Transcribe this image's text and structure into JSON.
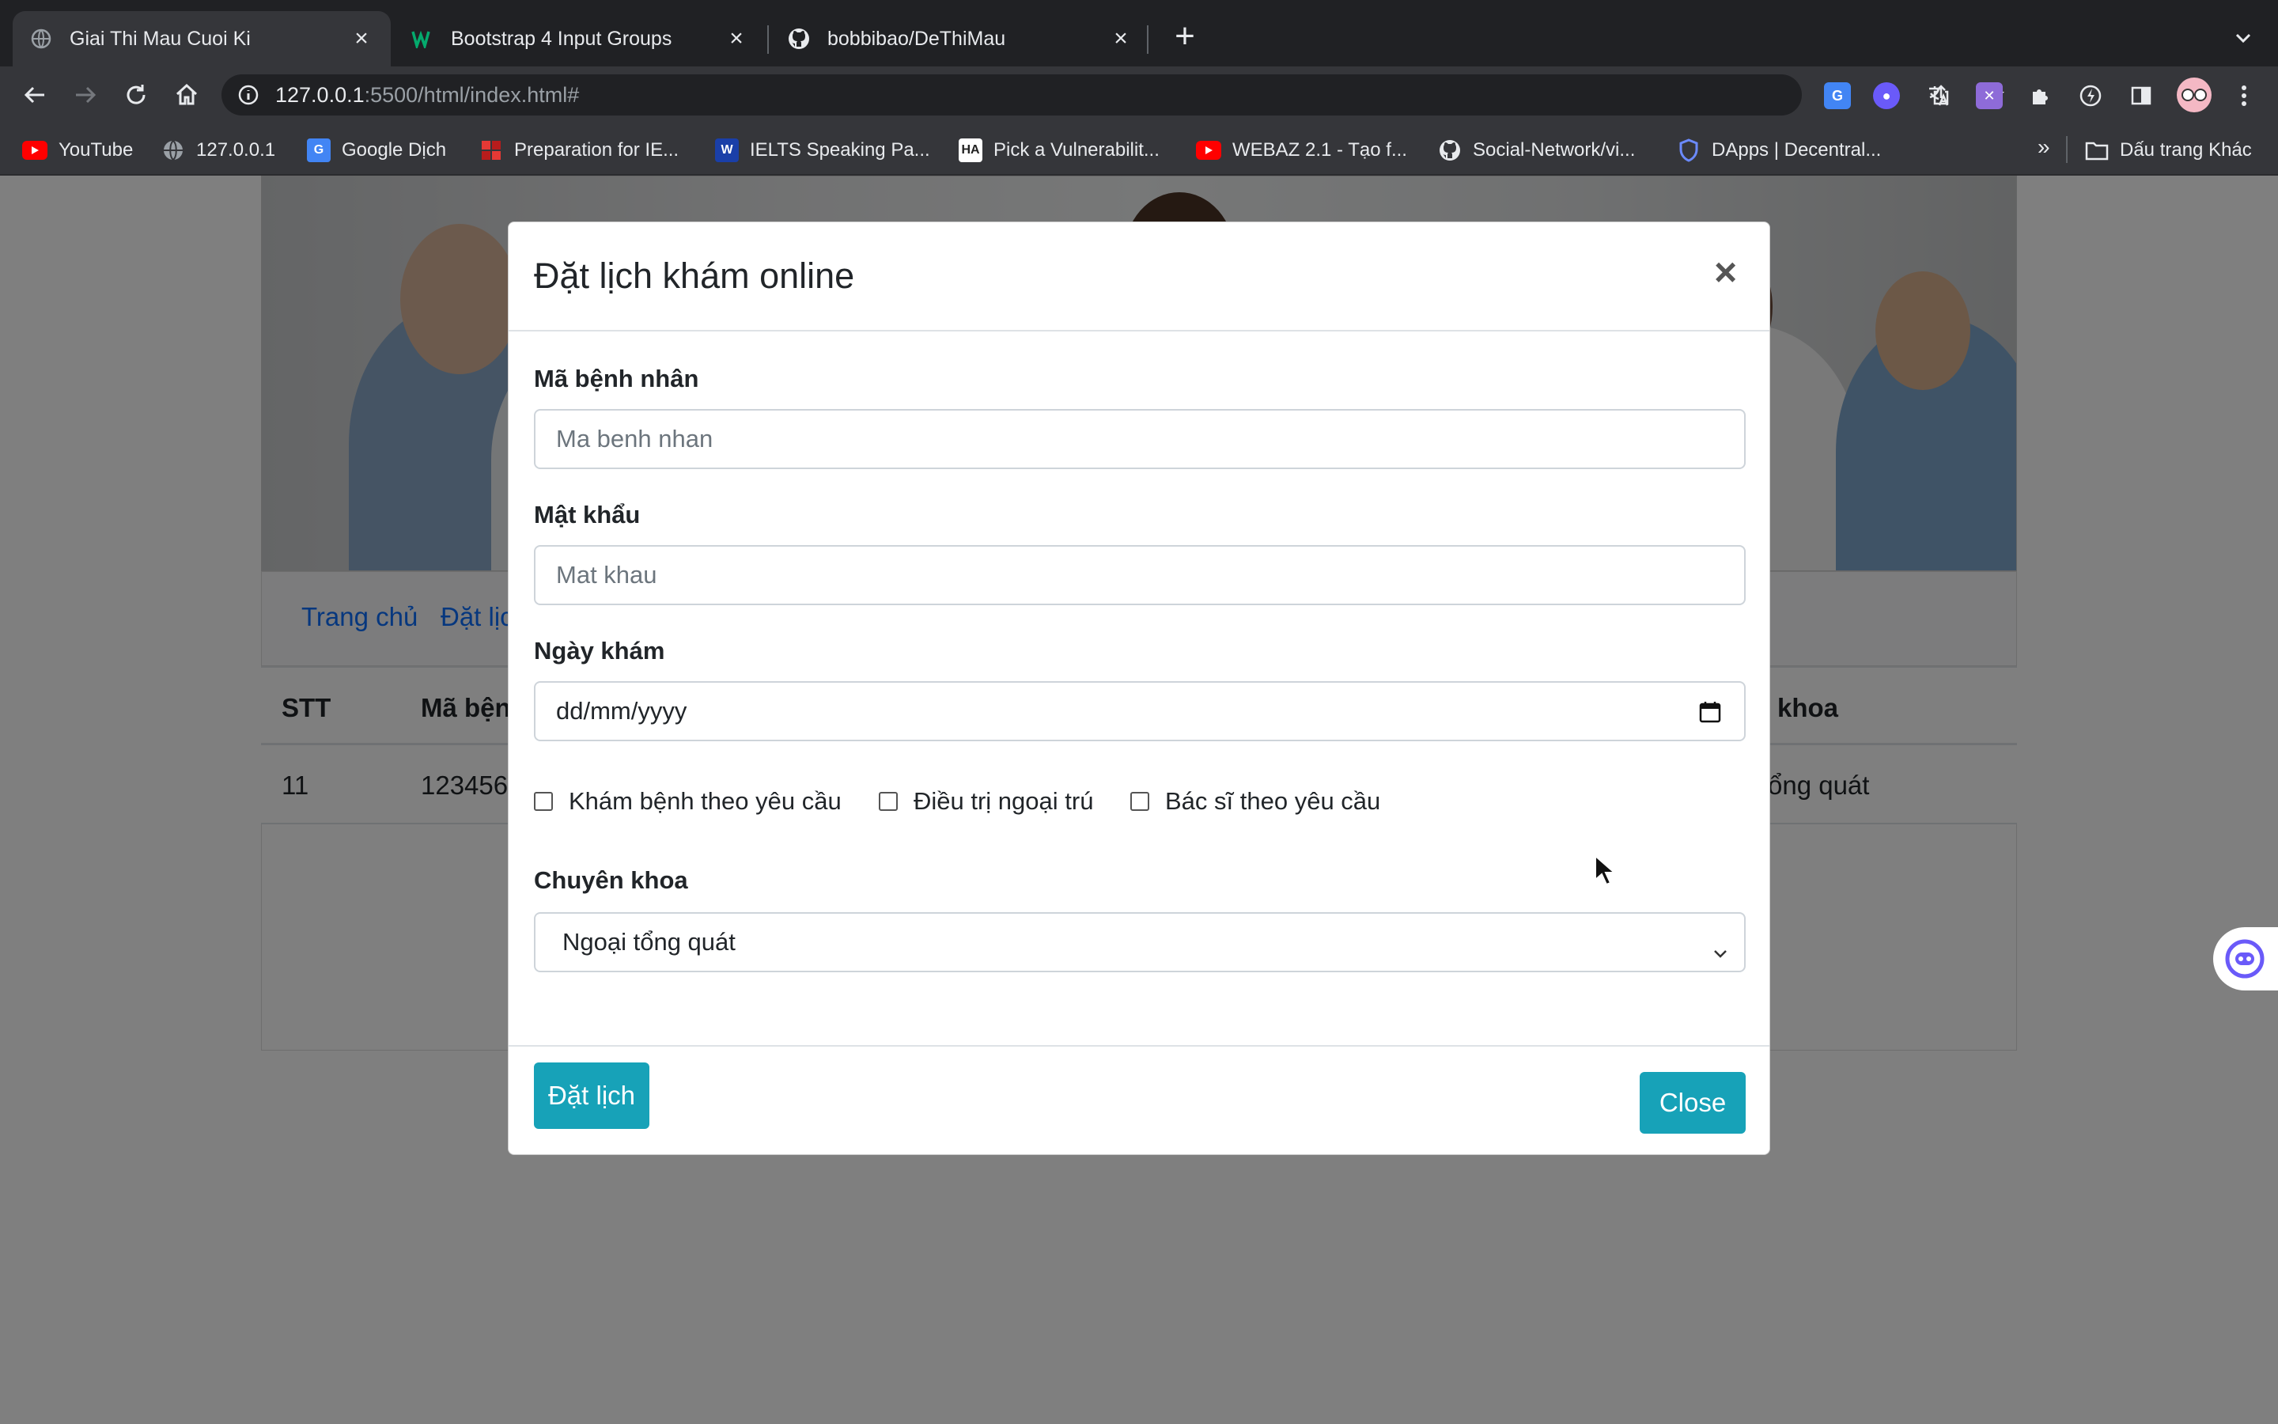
{
  "browser": {
    "tabs": [
      {
        "title": "Giai Thi Mau Cuoi Ki",
        "icon": "globe-icon",
        "active": true
      },
      {
        "title": "Bootstrap 4 Input Groups",
        "icon": "w3schools-icon",
        "active": false
      },
      {
        "title": "bobbibao/DeThiMau",
        "icon": "github-icon",
        "active": false
      }
    ],
    "url_host": "127.0.0.1",
    "url_rest": ":5500/html/index.html#",
    "bookmarks": [
      {
        "label": "YouTube",
        "icon": "youtube-icon"
      },
      {
        "label": "127.0.0.1",
        "icon": "globe-icon"
      },
      {
        "label": "Google Dịch",
        "icon": "google-translate-icon"
      },
      {
        "label": "Preparation for IE...",
        "icon": "bookmark-red-icon"
      },
      {
        "label": "IELTS Speaking Pa...",
        "icon": "bookmark-blue-icon"
      },
      {
        "label": "Pick a Vulnerabilit...",
        "icon": "hackerone-icon"
      },
      {
        "label": "WEBAZ 2.1 - Tạo f...",
        "icon": "youtube-icon"
      },
      {
        "label": "Social-Network/vi...",
        "icon": "github-icon"
      },
      {
        "label": "DApps | Decentral...",
        "icon": "shield-icon"
      }
    ],
    "bookmarks_more": "»",
    "other_bookmarks": "Dấu trang Khác"
  },
  "page": {
    "nav": [
      "Trang chủ",
      "Đặt lịc"
    ],
    "table": {
      "headers": [
        "STT",
        "Mã bện",
        "khoa"
      ],
      "row": [
        "11",
        "123456",
        "ổng quát"
      ]
    }
  },
  "modal": {
    "title": "Đặt lịch khám online",
    "close_x": "×",
    "fields": {
      "patient_id_label": "Mã bệnh nhân",
      "patient_id_placeholder": "Ma benh nhan",
      "password_label": "Mật khẩu",
      "password_placeholder": "Mat khau",
      "date_label": "Ngày khám",
      "date_placeholder": "dd/mm/yyyy",
      "checkboxes": [
        "Khám bệnh theo yêu cầu",
        "Điều trị ngoại trú",
        "Bác sĩ theo yêu cầu"
      ],
      "specialty_label": "Chuyên khoa",
      "specialty_value": "Ngoại tổng quát"
    },
    "submit_label": "Đặt lịch",
    "close_label": "Close"
  },
  "colors": {
    "accent_button": "#17a2b8",
    "link": "#0d6efd",
    "chrome_dark": "#202124",
    "chrome_toolbar": "#35363a"
  }
}
